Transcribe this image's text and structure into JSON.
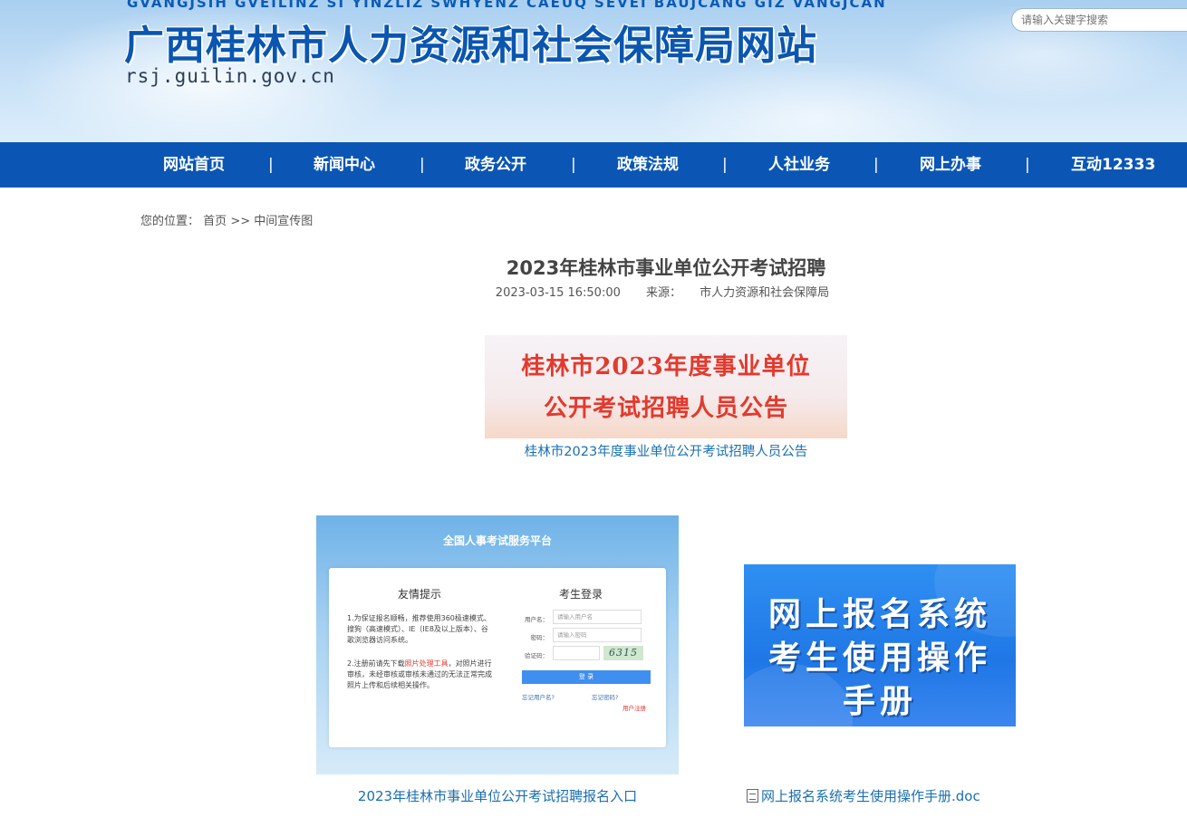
{
  "header": {
    "zhuang_text": "GVANGJSIH GVEILINZ SI YINZLIZ SWHYENZ CAEUQ SEVEI BAUJCANG GIZ VANGJCAN",
    "site_title": "广西桂林市人力资源和社会保障局网站",
    "domain": "rsj.guilin.gov.cn",
    "search_placeholder": "请输入关键字搜索"
  },
  "nav": {
    "items": [
      "网站首页",
      "新闻中心",
      "政务公开",
      "政策法规",
      "人社业务",
      "网上办事",
      "互动12333"
    ],
    "separator": "|"
  },
  "breadcrumb": {
    "prefix": "您的位置：",
    "home": "首页",
    "sep": ">>",
    "current": "中间宣传图"
  },
  "article": {
    "title": "2023年桂林市事业单位公开考试招聘",
    "date": "2023-03-15 16:50:00",
    "source_label": "来源：",
    "source": "市人力资源和社会保障局",
    "image1": {
      "line1": "桂林市2023年度事业单位",
      "line2": "公开考试招聘人员公告",
      "caption": "桂林市2023年度事业单位公开考试招聘人员公告"
    },
    "image2": {
      "platform": "全国人事考试服务平台",
      "tips_title": "友情提示",
      "tip1": "1.为保证报名顺畅，推荐使用360极速模式、搜狗（高速模式）、IE（IE8及以上版本）、谷歌浏览器访问系统。",
      "tip2_a": "2.注册前请先下载",
      "tip2_red": "照片处理工具",
      "tip2_b": "，对照片进行审核，未经审核或审核未通过的无法正常完成照片上传和后续相关操作。",
      "login_title": "考生登录",
      "username_label": "用户名：",
      "username_placeholder": "请输入用户名",
      "password_label": "密码：",
      "password_placeholder": "请输入密码",
      "captcha_label": "验证码：",
      "captcha": "6315",
      "login_button": "登 录",
      "forgot_user": "忘记用户名?",
      "forgot_pass": "忘记密码?",
      "register": "用户注册",
      "caption": "2023年桂林市事业单位公开考试招聘报名入口"
    },
    "image3": {
      "line1": "网上报名系统",
      "line2": "考生使用操作",
      "line3": "手册",
      "caption": "网上报名系统考生使用操作手册.doc"
    }
  }
}
